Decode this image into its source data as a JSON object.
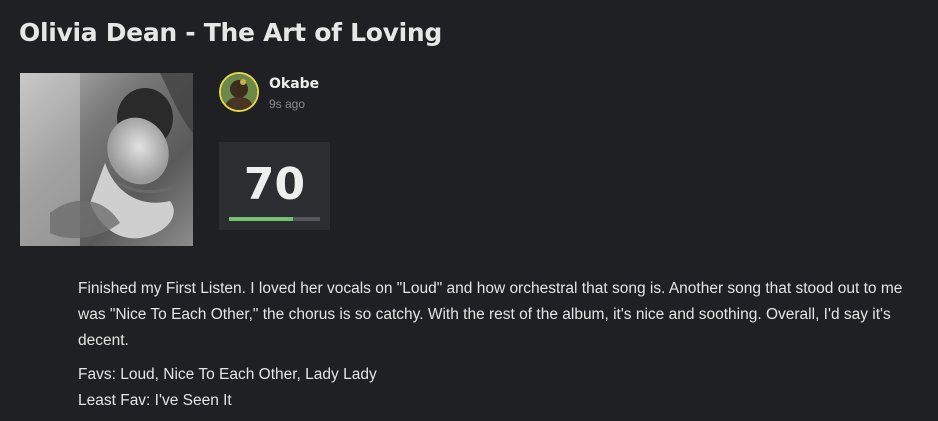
{
  "review": {
    "title": "Olivia Dean - The Art of Loving",
    "album_cover_alt": "The Art of Loving album cover",
    "user": {
      "name": "Okabe",
      "timestamp": "9s ago"
    },
    "score": {
      "value": "70",
      "fraction": 0.7,
      "bar_color": "#74c26f",
      "ring_color": "#e4d54a"
    },
    "body": "Finished my First Listen. I loved her vocals on \"Loud\" and how orchestral that song is. Another song that stood out to me was \"Nice To Each Other,\" the chorus is so catchy. With the rest of the album, it's nice and soothing. Overall, I'd say it's decent.",
    "favs": "Favs: Loud, Nice To Each Other, Lady Lady",
    "least_fav": "Least Fav: I've Seen It"
  }
}
